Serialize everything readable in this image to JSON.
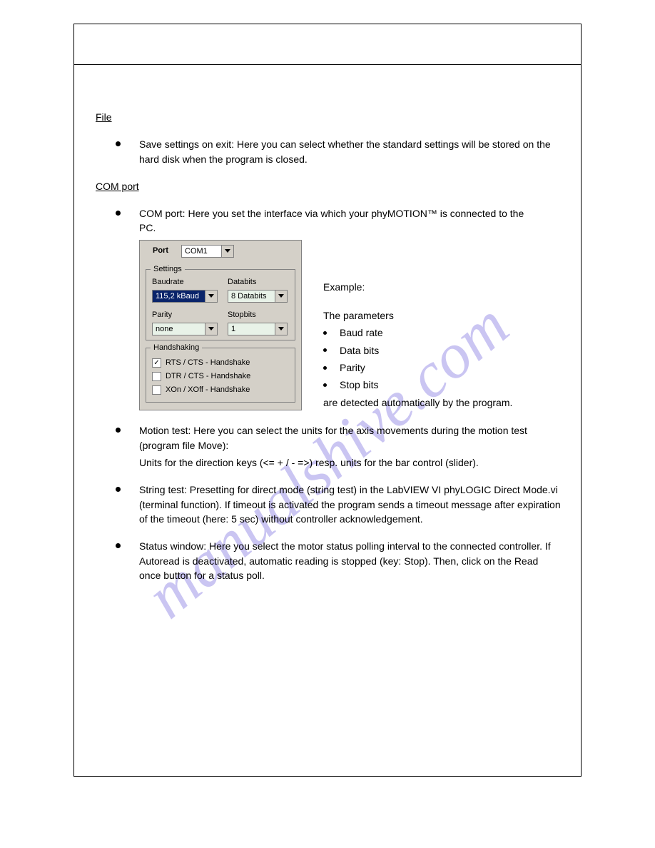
{
  "watermark": "manualshive.com",
  "file": {
    "title": "File"
  },
  "com": {
    "title": "COM port",
    "example_intro": "Example:"
  },
  "bullets": {
    "save": "Save settings on exit: Here you can select whether the standard settings will be stored on the hard disk when the program is closed.",
    "comport": "COM port: Here you set the interface via which your phyMOTION™ is connected to the PC.",
    "sideIntro": "The parameters",
    "sideParams": [
      "Baud rate",
      "Data bits",
      "Parity",
      "Stop bits"
    ],
    "sideOutro": "are detected automatically by the program.",
    "motiontest": "Motion test: Here you can select the units for the axis movements during the motion test (program file Move):",
    "mtkeys": "Units for the direction keys (<= + / - =>) resp. units for the bar control (slider).",
    "stringtest": "String test: Presetting for direct mode (string test) in the LabVIEW VI phyLOGIC Direct Mode.vi (terminal function). If timeout is activated the program sends a timeout message after expiration of the timeout (here: 5 sec) without controller acknowledgement.",
    "statuswindow": "Status window: Here you select the motor status polling interval to the connected controller. If Autoread is deactivated, automatic reading is stopped (key: Stop). Then, click on the Read once button for a status poll."
  },
  "dialog": {
    "portLabel": "Port",
    "port": {
      "value": "COM1"
    },
    "settingsGroup": "Settings",
    "baud": {
      "label": "Baudrate",
      "value": "115,2 kBaud"
    },
    "databits": {
      "label": "Databits",
      "value": "8 Databits"
    },
    "parity": {
      "label": "Parity",
      "value": "none"
    },
    "stopbits": {
      "label": "Stopbits",
      "value": "1"
    },
    "handshakingGroup": "Handshaking",
    "hs": {
      "rts": {
        "label": "RTS / CTS - Handshake",
        "checked": true
      },
      "dtr": {
        "label": "DTR / CTS - Handshake",
        "checked": false
      },
      "xon": {
        "label": "XOn / XOff - Handshake",
        "checked": false
      }
    }
  }
}
